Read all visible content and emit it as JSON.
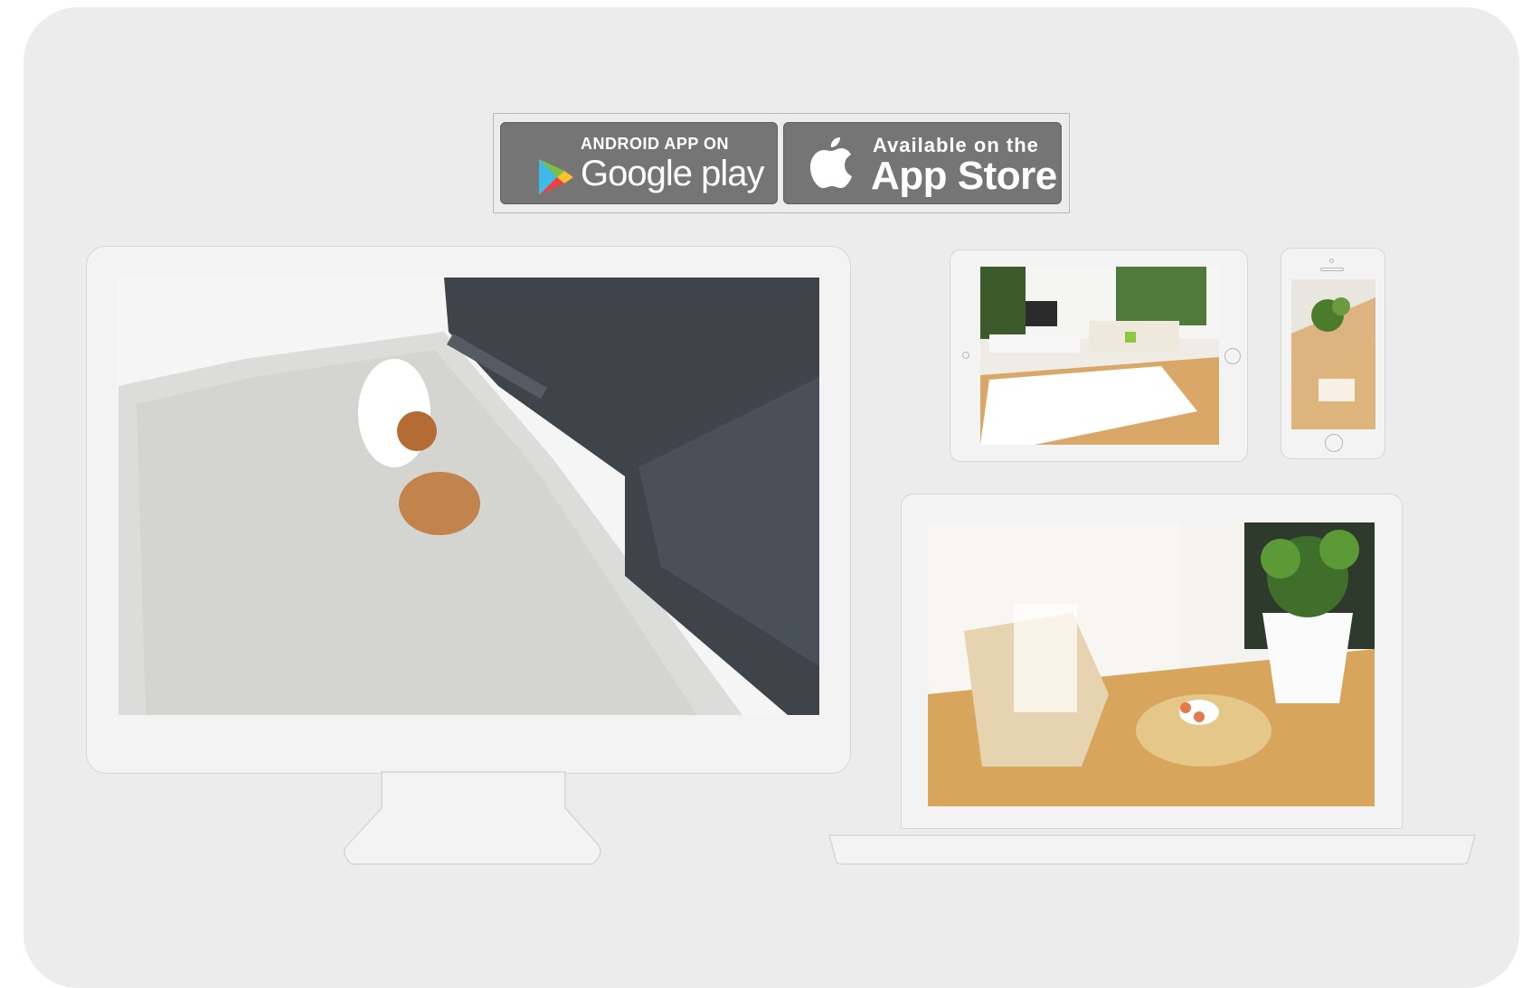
{
  "badges": {
    "google_play": {
      "small_label": "ANDROID APP ON",
      "big_label": "Google play",
      "icon": "google-play-icon"
    },
    "app_store": {
      "small_label": "Available on the",
      "big_label": "App Store",
      "icon": "apple-icon"
    }
  },
  "devices": {
    "monitor": {
      "scene": "dog-on-rug-living-room"
    },
    "tablet": {
      "scene": "living-room-with-tv"
    },
    "phone": {
      "scene": "plant-room-overhead"
    },
    "laptop": {
      "scene": "chair-and-plant-sunlit-room"
    }
  },
  "colors": {
    "background": "#ececec",
    "device": "#f3f3f3",
    "badge": "#757575"
  }
}
